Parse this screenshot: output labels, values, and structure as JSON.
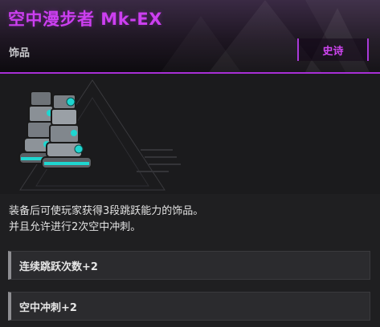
{
  "item": {
    "name": "空中漫步者 Mk-EX",
    "category": "饰品",
    "rarity": "史诗",
    "image_icon": "rocket-boots-icon"
  },
  "description": {
    "lines": [
      "装备后可使玩家获得3段跳跃能力的饰品。",
      "并且允许进行2次空中冲刺。"
    ]
  },
  "stats": [
    {
      "label": "连续跳跃次数+2"
    },
    {
      "label": "空中冲刺+2"
    }
  ],
  "colors": {
    "rarity_accent": "#cc3ff0",
    "divider": "#a82fd6",
    "boot_glow": "#1fd6d0"
  }
}
